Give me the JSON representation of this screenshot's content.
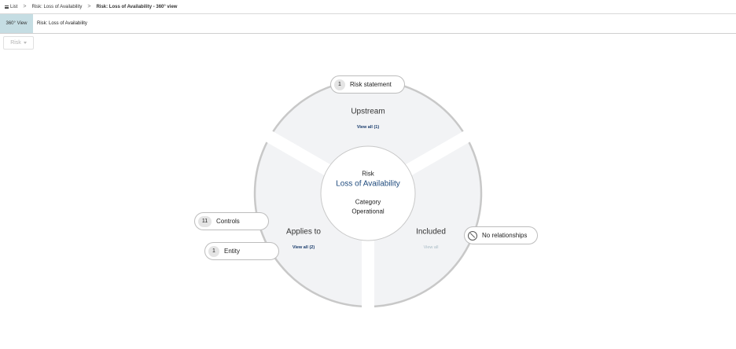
{
  "breadcrumb": {
    "list_label": "List",
    "parent_label": "Risk: Loss of Availability",
    "current_label": "Risk: Loss of Availability - 360° view",
    "separator": ">"
  },
  "tabs": {
    "active_label": "360° View",
    "title": "Risk: Loss of Availability"
  },
  "filter": {
    "label": "Risk"
  },
  "center": {
    "type_label": "Risk",
    "name": "Loss of Availability",
    "category_label": "Category",
    "category_value": "Operational"
  },
  "sectors": {
    "upstream": {
      "title": "Upstream",
      "link": "View all (1)"
    },
    "applies_to": {
      "title": "Applies to",
      "link": "View all (2)"
    },
    "included": {
      "title": "Included",
      "link": "View all"
    }
  },
  "pills": {
    "risk_statement": {
      "count": "1",
      "label": "Risk statement"
    },
    "controls": {
      "count": "11",
      "label": "Controls"
    },
    "entity": {
      "count": "1",
      "label": "Entity"
    },
    "no_relationships": {
      "label": "No relationships",
      "icon": "ban-icon"
    }
  },
  "colors": {
    "sector_fill": "#f2f3f5",
    "ring_stroke": "#c8c8c8",
    "accent_tab": "#c5dde3",
    "link": "#1b3d6d",
    "center_name": "#1e4a7d"
  }
}
